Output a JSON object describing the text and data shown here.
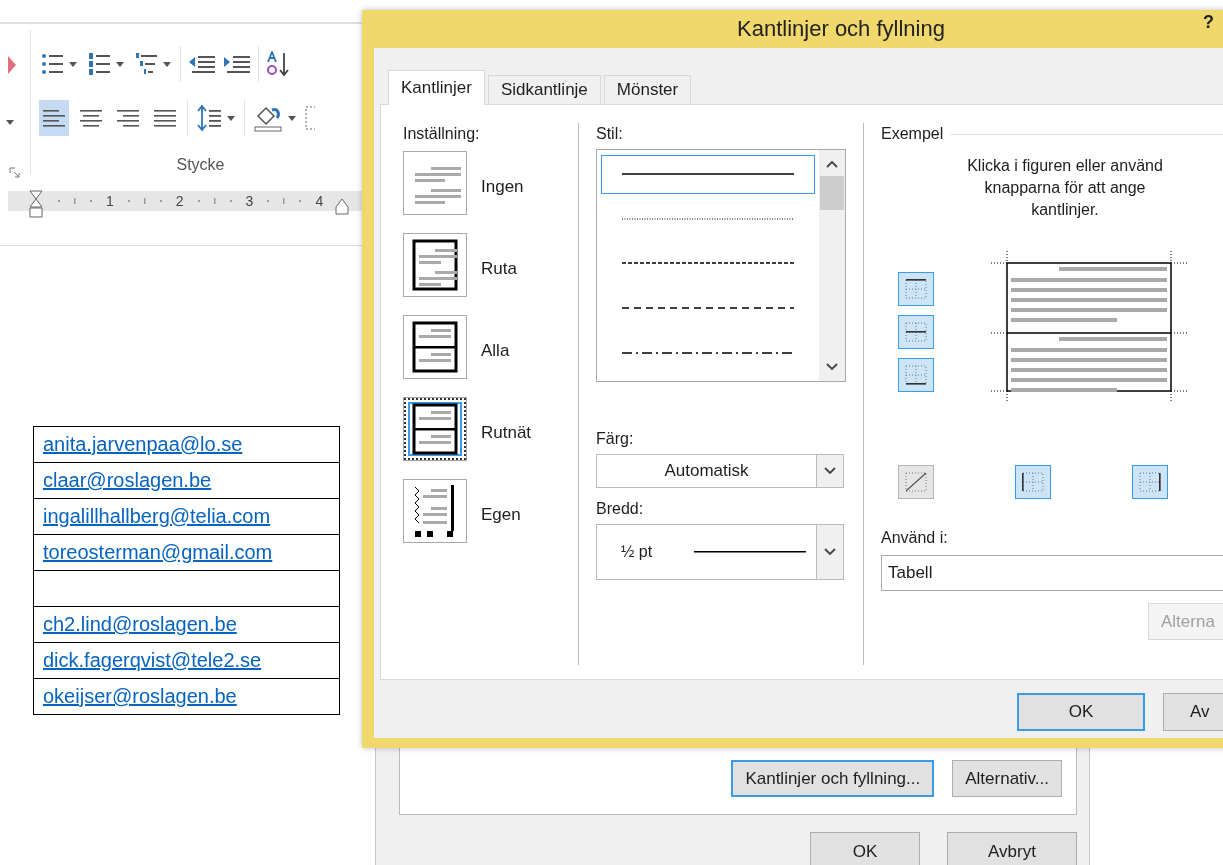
{
  "ribbon": {
    "list_buttons": [
      {
        "kind": "bullets"
      },
      {
        "kind": "numbering"
      },
      {
        "kind": "multilevel"
      }
    ],
    "alignment": [
      {
        "kind": "left",
        "selected": true
      },
      {
        "kind": "center",
        "selected": false
      },
      {
        "kind": "right",
        "selected": false
      },
      {
        "kind": "justify",
        "selected": false
      }
    ],
    "group_label": "Stycke",
    "ruler_labels": [
      "1",
      "2",
      "3",
      "4"
    ]
  },
  "document": {
    "table_rows": [
      {
        "kind": "link",
        "text": "anita.jarvenpaa@lo.se"
      },
      {
        "kind": "link",
        "text": "claar@roslagen.be"
      },
      {
        "kind": "link",
        "text": "ingalillhallberg@telia.com"
      },
      {
        "kind": "link",
        "text": "toreosterman@gmail.com"
      },
      {
        "kind": "blank"
      },
      {
        "kind": "link",
        "text": "ch2.lind@roslagen.be"
      },
      {
        "kind": "link",
        "text": "dick.fagerqvist@tele2.se"
      },
      {
        "kind": "link",
        "text": "okeijser@roslagen.be"
      }
    ]
  },
  "back_dialog": {
    "buttons": [
      {
        "label": "Kantlinjer och fyllning...",
        "focused": true
      },
      {
        "label": "Alternativ...",
        "focused": false
      }
    ],
    "footer_buttons": [
      "OK",
      "Avbryt"
    ]
  },
  "dialog": {
    "title": "Kantlinjer och fyllning",
    "help": "?",
    "tabs": [
      {
        "label": "Kantlinjer",
        "selected": true
      },
      {
        "label": "Sidkantlinje",
        "selected": false
      },
      {
        "label": "Mönster",
        "selected": false
      }
    ],
    "settings": {
      "label": "Inställning:",
      "items": [
        {
          "kind": "none",
          "label": "Ingen",
          "selected": false
        },
        {
          "kind": "box",
          "label": "Ruta",
          "selected": false
        },
        {
          "kind": "all",
          "label": "Alla",
          "selected": false
        },
        {
          "kind": "grid",
          "label": "Rutnät",
          "selected": true
        },
        {
          "kind": "custom",
          "label": "Egen",
          "selected": false
        }
      ]
    },
    "style": {
      "label": "Stil:",
      "options": [
        {
          "kind": "solid",
          "selected": true
        },
        {
          "kind": "dotted",
          "selected": false
        },
        {
          "kind": "dashed-small",
          "selected": false
        },
        {
          "kind": "dashed",
          "selected": false
        },
        {
          "kind": "dash-dot",
          "selected": false
        }
      ]
    },
    "color": {
      "label": "Färg:",
      "value": "Automatisk"
    },
    "width": {
      "label": "Bredd:",
      "value": "½ pt"
    },
    "preview": {
      "label": "Exempel",
      "hint": "Klicka i figuren eller använd knapparna för att ange kantlinjer.",
      "side_buttons": [
        {
          "kind": "top",
          "on": true
        },
        {
          "kind": "middle",
          "on": true
        },
        {
          "kind": "bottom",
          "on": true
        }
      ],
      "bottom_buttons": [
        {
          "kind": "diagonal",
          "on": false
        },
        {
          "kind": "left",
          "on": true
        },
        {
          "kind": "right",
          "on": true
        }
      ]
    },
    "apply_to": {
      "label": "Använd i:",
      "value": "Tabell"
    },
    "options_button": {
      "label": "Alterna",
      "disabled": true
    },
    "buttons": [
      "OK",
      "Av"
    ]
  }
}
